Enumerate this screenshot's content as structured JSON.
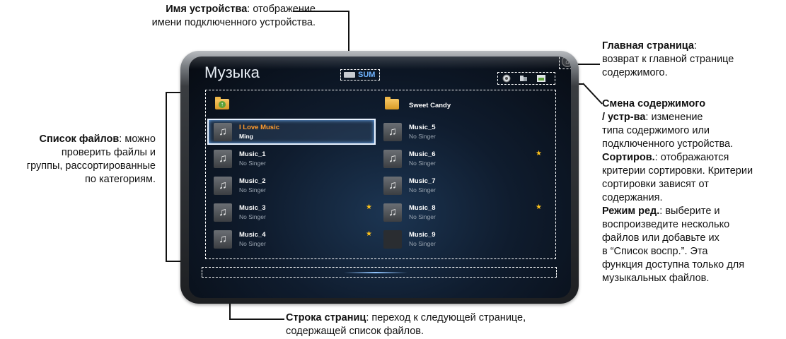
{
  "callouts": {
    "device_name": {
      "bold": "Имя устройства",
      "rest_line1": ": отображение",
      "line2": "имени подключенного устройства."
    },
    "home_page": {
      "bold": "Главная страница",
      "rest_line1": ":",
      "line2": "возврат к главной странице",
      "line3": "содержимого."
    },
    "file_list": {
      "bold": "Список файлов",
      "rest_line1": ": можно",
      "line2": "проверить файлы и",
      "line3": "группы, рассортированные",
      "line4": "по категориям."
    },
    "content_change": {
      "bold1": "Смена содержимого",
      "line2_bold": "/ устр-ва",
      "line2_rest": ": изменение",
      "line3": "типа содержимого или",
      "line4": "подключенного устройства.",
      "bold_sort": "Сортиров.",
      "sort_rest": ": отображаются",
      "line6": "критерии сортировки. Критерии",
      "line7": "сортировки зависят от",
      "line8": "содержания.",
      "bold_edit": "Режим ред.",
      "edit_rest": ": выберите и",
      "line10": "воспроизведите несколько",
      "line11": "файлов или добавьте их",
      "line12": "в “Список воспр.”. Эта",
      "line13": "функция доступна только для",
      "line14": "музыкальных файлов."
    },
    "page_bar": {
      "bold": "Строка страниц",
      "rest_line1": ": переход к следующей странице,",
      "line2": "содержащей список файлов."
    }
  },
  "screen": {
    "title": "Музыка",
    "device": "SUM",
    "icons": [
      "sort-icon",
      "content-change-icon",
      "edit-mode-icon",
      "home-icon"
    ]
  },
  "files": {
    "left": [
      {
        "name": "",
        "sub": "",
        "type": "folder-up"
      },
      {
        "name": "I Love Music",
        "sub": "Ming",
        "type": "music",
        "selected": true
      },
      {
        "name": "Music_1",
        "sub": "No Singer",
        "type": "music"
      },
      {
        "name": "Music_2",
        "sub": "No Singer",
        "type": "music"
      },
      {
        "name": "Music_3",
        "sub": "No Singer",
        "type": "music",
        "star": true
      },
      {
        "name": "Music_4",
        "sub": "No Singer",
        "type": "music",
        "star": true
      }
    ],
    "right": [
      {
        "name": "Sweet Candy",
        "sub": "",
        "type": "folder"
      },
      {
        "name": "Music_5",
        "sub": "No Singer",
        "type": "music"
      },
      {
        "name": "Music_6",
        "sub": "No Singer",
        "type": "music",
        "star": true
      },
      {
        "name": "Music_7",
        "sub": "No Singer",
        "type": "music"
      },
      {
        "name": "Music_8",
        "sub": "No Singer",
        "type": "music",
        "star": true
      },
      {
        "name": "Music_9",
        "sub": "No Singer",
        "type": "empty"
      }
    ],
    "star_glyph": "★",
    "note_glyph": "♫",
    "colors": {
      "selected_text": "#ff9b2d",
      "star": "#ffc21a",
      "device_text": "#6fb3ff"
    }
  }
}
